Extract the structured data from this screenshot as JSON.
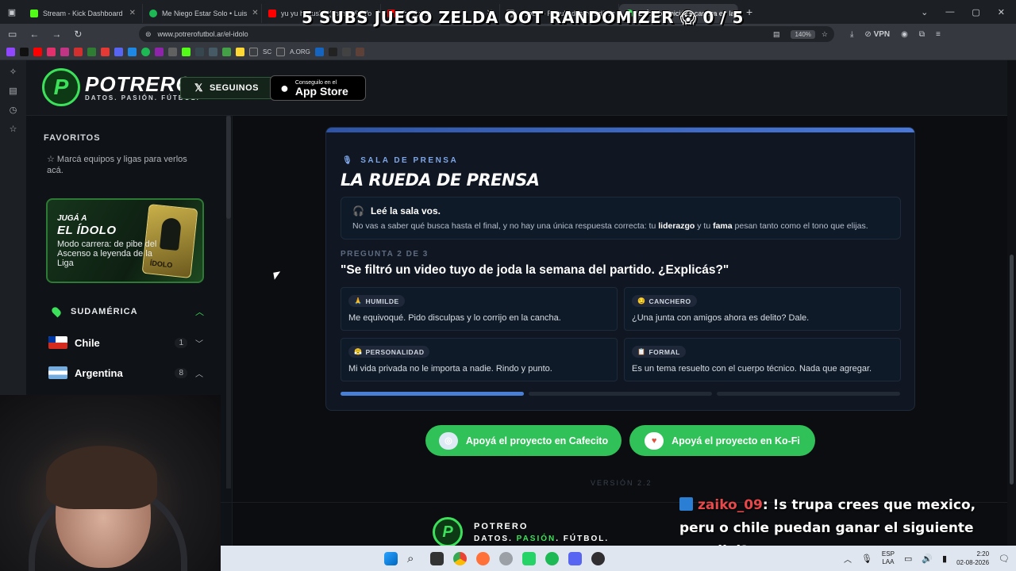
{
  "overlay_title": "5 SUBS JUEGO ZELDA OOT RANDOMIZER 😱 0 / 5",
  "browser": {
    "tabs": [
      {
        "label": "Stream - Kick Dashboard",
        "color": "#53fc18"
      },
      {
        "label": "Me Niego Estar Solo • Luis",
        "color": "#1db954"
      },
      {
        "label": "yu yu hakusho (español) (Vo",
        "color": "#ff0000"
      },
      {
        "label": "YouTube",
        "color": "#ff0000"
      },
      {
        "label": "Copa — Resultados estadístic",
        "color": "#6a6a6a"
      },
      {
        "label": "El Ídolo | Iniciá tu carrera en la Li",
        "color": "#3de05b"
      }
    ],
    "url": "www.potrerofutbol.ar/el-idolo",
    "zoom": "140%",
    "vpn": "VPN",
    "bookmarks": [
      "SC",
      "A.ORG"
    ]
  },
  "site": {
    "logo_name": "POTRERO",
    "logo_tagline": "DATOS. PASIÓN. FÚTBOL.",
    "follow_label": "SEGUINOS",
    "appstore_small": "Conseguilo en el",
    "appstore_big": "App Store"
  },
  "sidebar": {
    "favorites_title": "FAVORITOS",
    "favorites_hint": "Marcá equipos y ligas para verlos acá.",
    "promo_pre": "JUGÁ A",
    "promo_title": "EL ÍDOLO",
    "promo_desc": "Modo carrera: de pibe del Ascenso a leyenda de la Liga",
    "promo_card_label": "ÍDOLO",
    "region": "SUDAMÉRICA",
    "countries": [
      {
        "name": "Chile",
        "count": "1"
      },
      {
        "name": "Argentina",
        "count": "8"
      }
    ]
  },
  "card": {
    "eyebrow": "SALA DE PRENSA",
    "title": "LA RUEDA DE PRENSA",
    "intro_title": "Leé la sala vos.",
    "intro_text_a": "No vas a saber qué busca hasta el final, y no hay una única respuesta correcta: tu ",
    "intro_bold_a": "liderazgo",
    "intro_text_b": " y tu ",
    "intro_bold_b": "fama",
    "intro_text_c": " pesan tanto como el tono que elijas.",
    "question_label": "PREGUNTA 2 DE 3",
    "question": "\"Se filtró un video tuyo de joda la semana del partido. ¿Explicás?\"",
    "options": [
      {
        "tag": "HUMILDE",
        "emoji": "🙏",
        "text": "Me equivoqué. Pido disculpas y lo corrijo en la cancha."
      },
      {
        "tag": "CANCHERO",
        "emoji": "😏",
        "text": "¿Una junta con amigos ahora es delito? Dale."
      },
      {
        "tag": "PERSONALIDAD",
        "emoji": "😤",
        "text": "Mi vida privada no le importa a nadie. Rindo y punto."
      },
      {
        "tag": "FORMAL",
        "emoji": "📋",
        "text": "Es un tema resuelto con el cuerpo técnico. Nada que agregar."
      }
    ],
    "progress": [
      1,
      0,
      0
    ]
  },
  "support": {
    "cafecito": "Apoyá el proyecto en Cafecito",
    "kofi": "Apoyá el proyecto en Ko-Fi"
  },
  "version": "VERSIÓN 2.2",
  "footer": {
    "name": "POTRERO",
    "tag_a": "DATOS. ",
    "tag_b": "PASIÓN",
    "tag_c": ". FÚTBOL."
  },
  "chat": {
    "user": "zaiko_09",
    "message": ": !s trupa crees que mexico, peru o chile puedan ganar el siguiente mundial?"
  },
  "taskbar": {
    "lang_top": "ESP",
    "lang_bottom": "LAA",
    "time": "2:20",
    "date": "02-08-2026"
  }
}
